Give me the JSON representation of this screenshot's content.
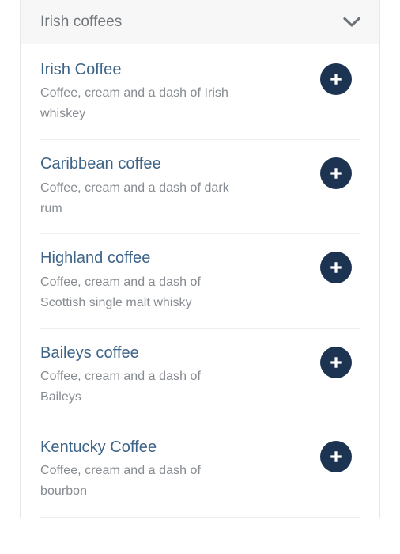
{
  "accent_colors": {
    "button_navy": "#1c3352",
    "title_blue": "#3e6488",
    "description_gray": "#868b91",
    "header_gray": "#71767c",
    "header_background": "#f7f7f7",
    "divider": "#eceef0",
    "card_border": "#e4e6e8"
  },
  "card": {
    "header": {
      "title": "Irish coffees",
      "toggle_icon": "chevron-down-icon"
    },
    "items": [
      {
        "title": "Irish Coffee",
        "description": "Coffee, cream and a dash of Irish whiskey",
        "add_icon": "plus-icon"
      },
      {
        "title": "Caribbean coffee",
        "description": "Coffee, cream and a dash of dark rum",
        "add_icon": "plus-icon"
      },
      {
        "title": "Highland coffee",
        "description": "Coffee, cream and a dash of Scottish single malt whisky",
        "add_icon": "plus-icon"
      },
      {
        "title": "Baileys coffee",
        "description": "Coffee, cream and a dash of Baileys",
        "add_icon": "plus-icon"
      },
      {
        "title": "Kentucky Coffee",
        "description": "Coffee, cream and a dash of bourbon",
        "add_icon": "plus-icon"
      }
    ]
  }
}
